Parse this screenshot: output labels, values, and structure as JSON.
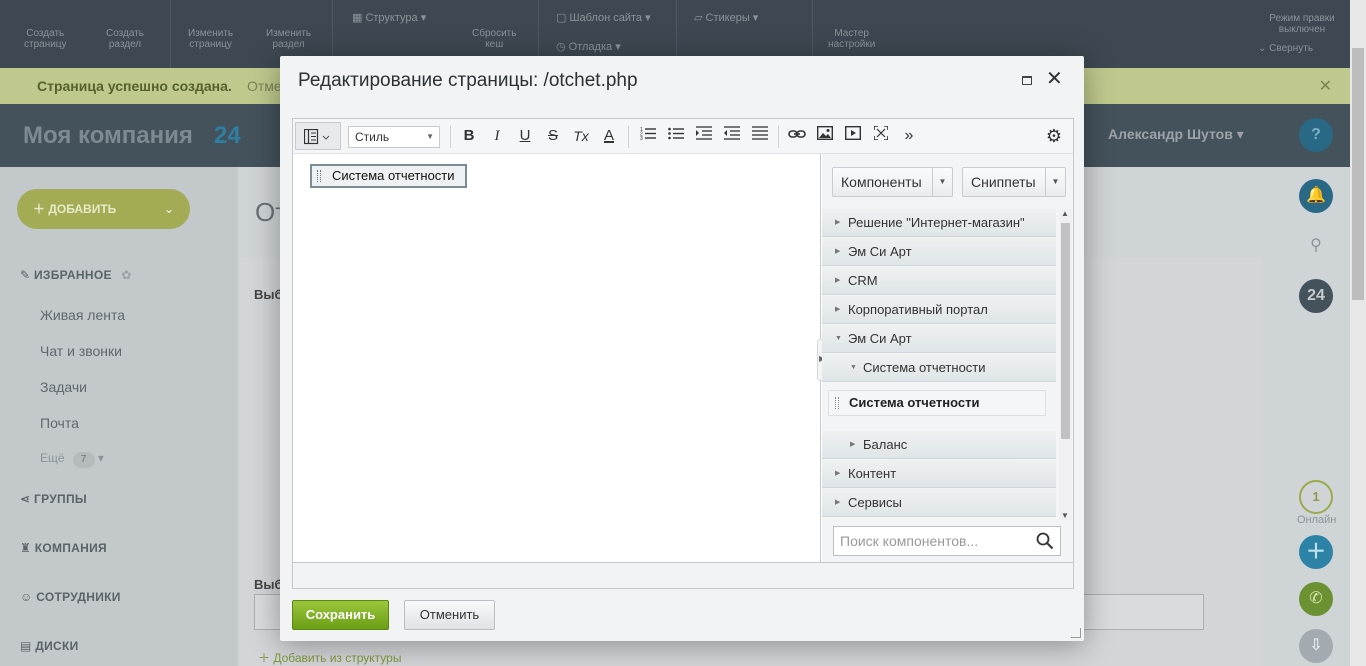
{
  "admin_panel": {
    "items": [
      {
        "label": "Создать\nстраницу"
      },
      {
        "label": "Создать\nраздел"
      },
      {
        "label": "Изменить\nстраницу"
      },
      {
        "label": "Изменить\nраздел"
      },
      {
        "label": "Структура"
      },
      {
        "label": "Сбросить\nкеш"
      },
      {
        "label": "Шаблон сайта"
      },
      {
        "label": "Отладка"
      },
      {
        "label": "Стикеры"
      },
      {
        "label": "Мастер\nнастройки"
      }
    ],
    "edit_mode": "Режим правки\nвыключен",
    "collapse": "Свернуть"
  },
  "notice": {
    "text": "Страница успешно создана.",
    "cancel": "Отме"
  },
  "portal": {
    "title": "Моя компания",
    "badge": "24",
    "user": "Александр Шутов"
  },
  "left_menu": {
    "add_button": "ДОБАВИТЬ",
    "favorites": "ИЗБРАННОЕ",
    "items": [
      "Живая лента",
      "Чат и звонки",
      "Задачи",
      "Почта"
    ],
    "more": "Ещё",
    "more_count": "7",
    "sections": [
      "ГРУППЫ",
      "КОМПАНИЯ",
      "СОТРУДНИКИ",
      "ДИСКИ"
    ]
  },
  "content": {
    "title": "От",
    "section_label": "Выб",
    "section_label_2": "Выб",
    "add_from_structure": "Добавить из структуры"
  },
  "right_rail": {
    "online_count": "1",
    "online_label": "Онлайн",
    "help": "?",
    "counter": "24"
  },
  "dialog": {
    "title": "Редактирование страницы: /otchet.php",
    "toolbar": {
      "style_select": "Стиль",
      "bold": "B",
      "italic": "I",
      "underline": "U",
      "strike": "S",
      "clear_format": "Tx",
      "font_color": "A",
      "more": "»"
    },
    "editor_component": "Система отчетности",
    "components_panel": {
      "components_button": "Компоненты",
      "snippets_button": "Сниппеты",
      "tree": [
        {
          "label": "Решение \"Интернет-магазин\"",
          "expanded": false,
          "level": 0
        },
        {
          "label": "Эм Си Арт",
          "expanded": false,
          "level": 0
        },
        {
          "label": "CRM",
          "expanded": false,
          "level": 0
        },
        {
          "label": "Корпоративный портал",
          "expanded": false,
          "level": 0
        },
        {
          "label": "Эм Си Арт",
          "expanded": true,
          "level": 0
        },
        {
          "label": "Система отчетности",
          "expanded": true,
          "level": 1
        },
        {
          "label": "Система отчетности",
          "type": "component",
          "level": 2
        },
        {
          "label": "Баланс",
          "expanded": false,
          "level": 1
        },
        {
          "label": "Контент",
          "expanded": false,
          "level": 0
        },
        {
          "label": "Сервисы",
          "expanded": false,
          "level": 0
        }
      ],
      "search_placeholder": "Поиск компонентов..."
    },
    "save_button": "Сохранить",
    "cancel_button": "Отменить"
  },
  "colors": {
    "save_green": "#7aad20",
    "admin_bar": "#3d4852",
    "accent_blue": "#2e7fa2"
  }
}
